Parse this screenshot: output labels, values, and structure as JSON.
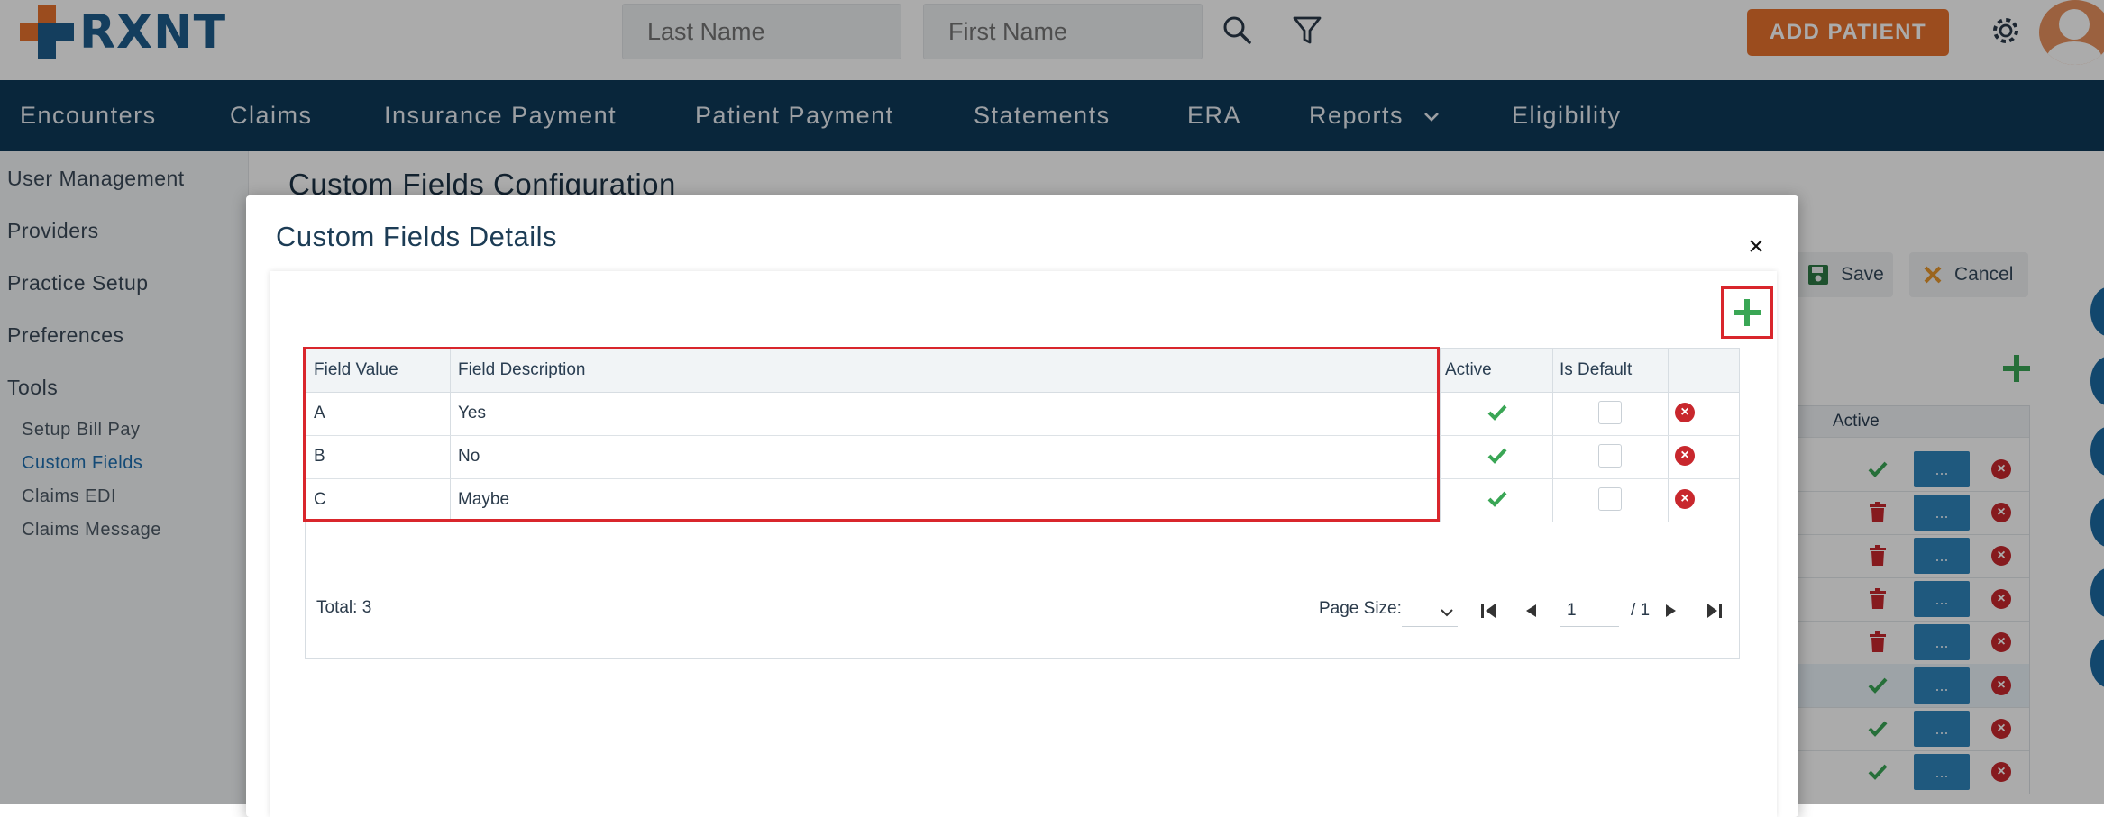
{
  "header": {
    "logo_text": "RXNT",
    "search": {
      "last_name_placeholder": "Last Name",
      "first_name_placeholder": "First Name"
    },
    "add_patient_label": "ADD PATIENT"
  },
  "nav": {
    "items": [
      "Encounters",
      "Claims",
      "Insurance Payment",
      "Patient Payment",
      "Statements",
      "ERA",
      "Reports",
      "Eligibility"
    ]
  },
  "sidebar": {
    "items": [
      "User Management",
      "Providers",
      "Practice Setup",
      "Preferences",
      "Tools"
    ],
    "sub_items": [
      "Setup Bill Pay",
      "Custom Fields",
      "Claims EDI",
      "Claims Message"
    ],
    "active_sub": "Custom Fields"
  },
  "page": {
    "title": "Custom Fields Configuration",
    "save_label": "Save",
    "cancel_label": "Cancel",
    "active_header": "Active",
    "ellipsis": "...",
    "bg_rows": [
      "check",
      "trash",
      "trash",
      "trash",
      "trash",
      "check",
      "check",
      "check"
    ]
  },
  "modal": {
    "title": "Custom Fields Details",
    "columns": [
      "Field Value",
      "Field Description",
      "Active",
      "Is Default"
    ],
    "rows": [
      {
        "value": "A",
        "description": "Yes",
        "active": true,
        "is_default": false
      },
      {
        "value": "B",
        "description": "No",
        "active": true,
        "is_default": false
      },
      {
        "value": "C",
        "description": "Maybe",
        "active": true,
        "is_default": false
      }
    ],
    "total_label": "Total: 3",
    "page_size_label": "Page Size:",
    "page_value": "1",
    "page_total": "/ 1"
  },
  "colors": {
    "brand_blue": "#1e5d8c",
    "nav_bg": "#0e3a58",
    "accent_orange": "#e8722d",
    "success_green": "#3aa655",
    "danger_red": "#c8272d",
    "highlight_red": "#d9262c"
  }
}
